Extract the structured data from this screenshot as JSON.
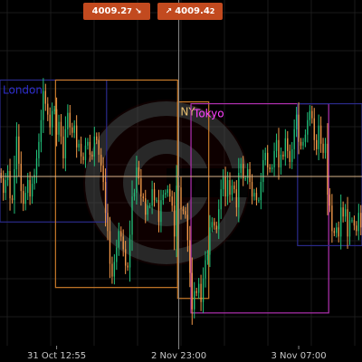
{
  "toolbar": {
    "sell_price": "4009.2",
    "sell_pip": "7",
    "buy_price": "4009.4",
    "buy_pip": "2"
  },
  "colors": {
    "background": "#000000",
    "grid": "#1a1a1a",
    "bull_candle": "#22c07a",
    "bear_candle": "#f2994a",
    "price_line": "#d9b38c",
    "crosshair": "#8a8a8a",
    "london": "#2a2a8a",
    "newyork": "#c87a2a",
    "tokyo": "#b030b0",
    "pill": "#c24a1f"
  },
  "chart_data": {
    "type": "candlestick",
    "x_ticks": [
      "31 Oct 12:55",
      "2 Nov 23:00",
      "3 Nov 07:00"
    ],
    "current_price": 4009.3,
    "sessions": [
      {
        "label": "London",
        "color": "#2a2a8a",
        "label_color": "#2f2fd0",
        "start": 0,
        "end": 48,
        "high": 4014.6,
        "low": 4006.8
      },
      {
        "label": "",
        "color": "#c87a2a",
        "label_color": "#c87a2a",
        "start": 25,
        "end": 80,
        "high": 4014.6,
        "low": 4003.2
      },
      {
        "label": "NY",
        "color": "#c87a2a",
        "label_color": "#e8c070",
        "start": 80,
        "end": 94,
        "high": 4013.4,
        "low": 4002.6
      },
      {
        "label": "Tokyo",
        "color": "#b030b0",
        "label_color": "#ff40ff",
        "start": 86,
        "end": 148,
        "high": 4013.3,
        "low": 4001.8
      },
      {
        "label": "",
        "color": "#2a2a8a",
        "label_color": "#2f2fd0",
        "start": 134,
        "end": 163,
        "high": 4013.3,
        "low": 4005.5
      }
    ],
    "close": [
      4009.2,
      4008.4,
      4009.1,
      4009.6,
      4008.1,
      4008.0,
      4009.7,
      4011.5,
      4010.0,
      4008.5,
      4007.8,
      4008.4,
      4009.1,
      4008.2,
      4008.9,
      4009.4,
      4010.3,
      4011.2,
      4012.4,
      4014.0,
      4013.3,
      4012.7,
      4012.0,
      4012.9,
      4013.0,
      4011.6,
      4012.3,
      4011.5,
      4010.3,
      4011.9,
      4012.8,
      4012.0,
      4011.7,
      4012.1,
      4010.9,
      4011.1,
      4010.4,
      4010.2,
      4011.0,
      4011.2,
      4010.5,
      4010.4,
      4011.5,
      4011.3,
      4010.5,
      4009.9,
      4009.0,
      4007.3,
      4006.3,
      4004.5,
      4003.8,
      4004.6,
      4005.4,
      4006.3,
      4006.0,
      4005.3,
      4004.4,
      4004.3,
      4006.1,
      4008.2,
      4008.4,
      4009.8,
      4009.2,
      4008.2,
      4008.1,
      4007.2,
      4007.7,
      4007.7,
      4008.6,
      4008.0,
      4008.0,
      4006.8,
      4008.0,
      4008.3,
      4008.4,
      4008.6,
      4008.2,
      4007.7,
      4006.0,
      4008.8,
      4008.7,
      4007.5,
      4007.4,
      4007.2,
      4005.8,
      4004.0,
      4002.0,
      4003.0,
      4002.9,
      4003.4,
      4002.4,
      4003.7,
      4004.7,
      4005.0,
      4006.5,
      4006.8,
      4006.6,
      4006.4,
      4007.5,
      4008.6,
      4009.3,
      4008.2,
      4009.1,
      4008.3,
      4008.8,
      4008.6,
      4007.6,
      4009.5,
      4010.0,
      4009.2,
      4009.2,
      4009.7,
      4009.0,
      4008.2,
      4008.4,
      4008.0,
      4008.0,
      4009.0,
      4010.2,
      4010.6,
      4009.8,
      4009.7,
      4009.8,
      4010.7,
      4011.3,
      4009.8,
      4010.5,
      4010.4,
      4011.4,
      4010.7,
      4010.1,
      4010.8,
      4011.9,
      4012.7,
      4011.2,
      4011.0,
      4011.2,
      4011.6,
      4012.4,
      4012.9,
      4012.5,
      4011.3,
      4010.8,
      4012.1,
      4011.1,
      4010.6,
      4011.1,
      4008.3,
      4007.7,
      4006.3,
      4006.2,
      4006.5,
      4006.0,
      4007.6,
      4007.1,
      4007.5,
      4006.0,
      4006.9,
      4006.9,
      4006.6,
      4006.3,
      4007.3,
      4006.5
    ],
    "ylim": [
      4000,
      4019
    ]
  }
}
